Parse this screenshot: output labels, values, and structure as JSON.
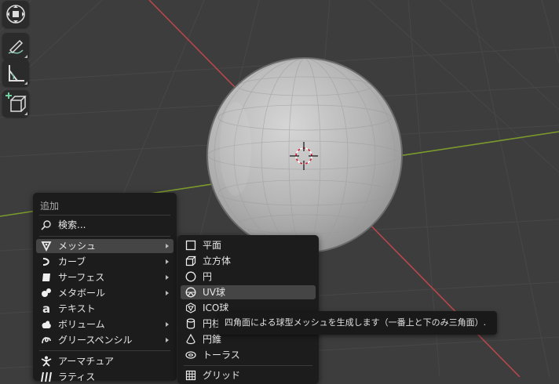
{
  "add_menu": {
    "title": "追加",
    "search_label": "検索...",
    "items": [
      {
        "label": "メッシュ",
        "icon": "mesh-icon",
        "submenu": true,
        "highlighted": true
      },
      {
        "label": "カーブ",
        "icon": "curve-icon",
        "submenu": true
      },
      {
        "label": "サーフェス",
        "icon": "surface-icon",
        "submenu": true
      },
      {
        "label": "メタボール",
        "icon": "metaball-icon",
        "submenu": true
      },
      {
        "label": "テキスト",
        "icon": "text-icon",
        "submenu": false
      },
      {
        "label": "ボリューム",
        "icon": "volume-icon",
        "submenu": true
      },
      {
        "label": "グリースペンシル",
        "icon": "grease-pencil-icon",
        "submenu": true
      },
      {
        "label": "アーマチュア",
        "icon": "armature-icon",
        "submenu": false
      },
      {
        "label": "ラティス",
        "icon": "lattice-icon",
        "submenu": false
      }
    ]
  },
  "mesh_submenu": {
    "items": [
      {
        "label": "平面",
        "icon": "plane-icon"
      },
      {
        "label": "立方体",
        "icon": "cube-icon"
      },
      {
        "label": "円",
        "icon": "circle-icon"
      },
      {
        "label": "UV球",
        "icon": "uv-sphere-icon",
        "highlighted": true
      },
      {
        "label": "ICO球",
        "icon": "ico-sphere-icon"
      },
      {
        "label": "円柱",
        "icon": "cylinder-icon"
      },
      {
        "label": "円錐",
        "icon": "cone-icon"
      },
      {
        "label": "トーラス",
        "icon": "torus-icon"
      },
      {
        "label": "グリッド",
        "icon": "grid-icon"
      }
    ]
  },
  "tooltip": {
    "text": "四角面による球型メッシュを生成します（一番上と下のみ三角面）."
  },
  "toolbar": {
    "tools": [
      "move-view-icon",
      "annotate-icon",
      "measure-icon",
      "add-cube-icon"
    ]
  },
  "colors": {
    "viewport_bg": "#3d3d3d",
    "grid_line": "#474747",
    "x_axis": "#b8474d",
    "y_axis": "#7c9a2c",
    "menu_bg": "#1c1c1c",
    "menu_highlight": "#454545"
  }
}
